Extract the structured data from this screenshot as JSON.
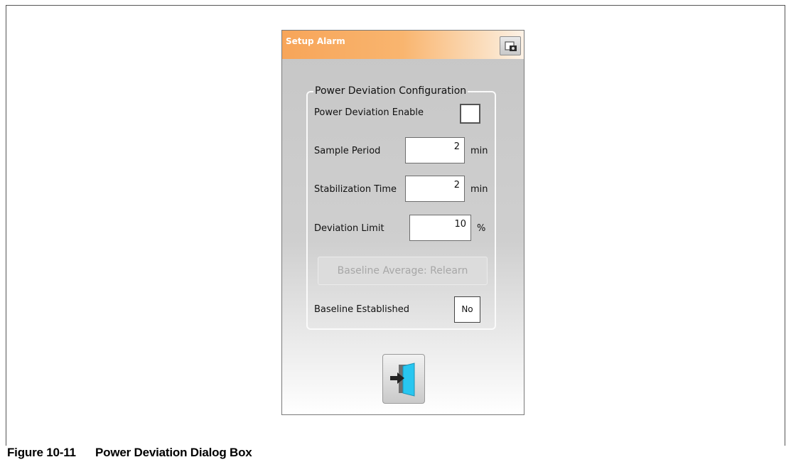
{
  "dialog": {
    "title": "Setup Alarm",
    "group_title": "Power Deviation Configuration",
    "enable_label": "Power Deviation Enable",
    "enable_checked": false,
    "sample_period": {
      "label": "Sample Period",
      "value": "2",
      "unit": "min"
    },
    "stabilization_time": {
      "label": "Stabilization Time",
      "value": "2",
      "unit": "min"
    },
    "deviation_limit": {
      "label": "Deviation Limit",
      "value": "10",
      "unit": "%"
    },
    "relearn_button": "Baseline Average: Relearn",
    "baseline_established": {
      "label": "Baseline Established",
      "value": "No"
    },
    "snapshot_icon": "camera-icon",
    "exit_icon": "exit-door-icon"
  },
  "caption": {
    "number": "Figure 10-11",
    "text": "Power Deviation Dialog Box"
  }
}
